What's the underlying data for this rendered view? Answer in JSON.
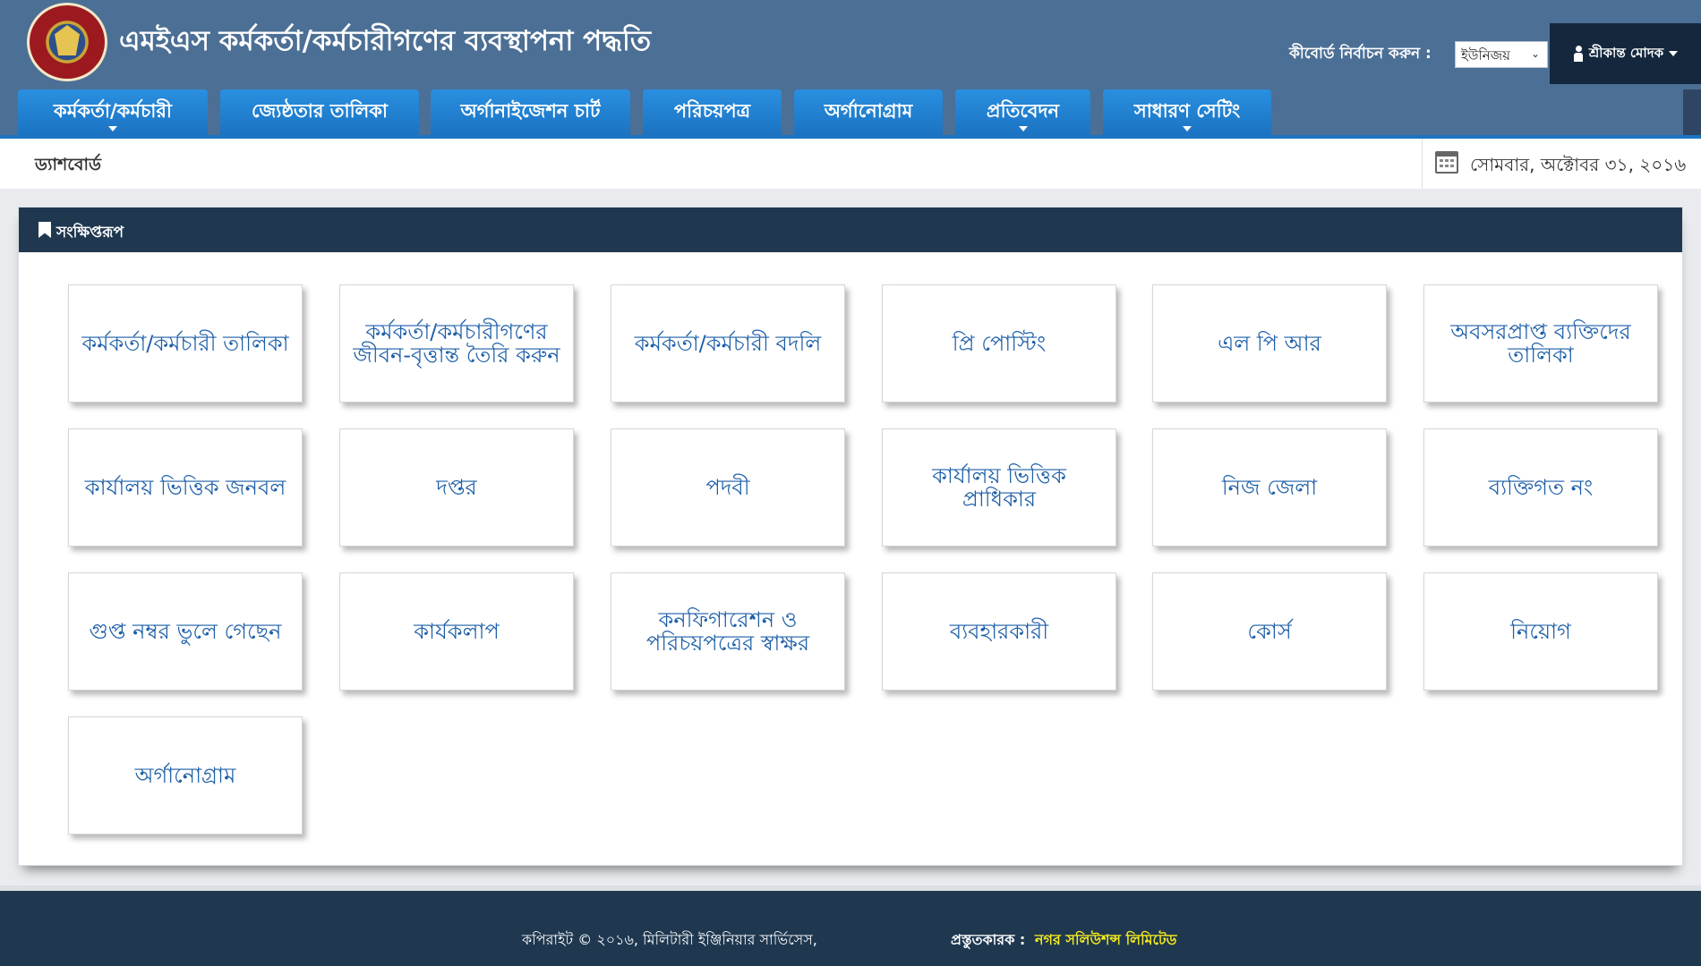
{
  "header": {
    "title": "এমইএস কর্মকর্তা/কর্মচারীগণের ব্যবস্থাপনা পদ্ধতি",
    "keyboard_label": "কীবোর্ড নির্বাচন করুন :",
    "keyboard_value": "ইউনিজয়",
    "user_name": "শ্রীকান্ত মোদক",
    "colors": {
      "header_bg": "#4c6f95",
      "user_bg": "#14273d"
    }
  },
  "nav": [
    {
      "label": "কর্মকর্তা/কর্মচারী",
      "dropdown": true
    },
    {
      "label": "জ্যেষ্ঠতার তালিকা",
      "dropdown": false
    },
    {
      "label": "অর্গানাইজেশন চার্ট",
      "dropdown": false
    },
    {
      "label": "পরিচয়পত্র",
      "dropdown": false
    },
    {
      "label": "অর্গানোগ্রাম",
      "dropdown": false
    },
    {
      "label": "প্রতিবেদন",
      "dropdown": true
    },
    {
      "label": "সাধারণ সেটিং",
      "dropdown": true
    }
  ],
  "breadcrumb": "ড্যাশবোর্ড",
  "date": "সোমবার, অক্টোবর ৩১, ২০১৬",
  "panel": {
    "title": "সংক্ষিপ্তরূপ",
    "tiles": [
      "কর্মকর্তা/কর্মচারী তালিকা",
      "কর্মকর্তা/কর্মচারীগণের জীবন-বৃত্তান্ত তৈরি করুন",
      "কর্মকর্তা/কর্মচারী বদলি",
      "প্রি পোস্টিং",
      "এল পি আর",
      "অবসরপ্রাপ্ত ব্যক্তিদের তালিকা",
      "কার্যালয় ভিত্তিক জনবল",
      "দপ্তর",
      "পদবী",
      "কার্যালয় ভিত্তিক প্রাধিকার",
      "নিজ জেলা",
      "ব্যক্তিগত নং",
      "গুপ্ত নম্বর ভুলে গেছেন",
      "কার্যকলাপ",
      "কনফিগারেশন ও পরিচয়পত্রের স্বাক্ষর",
      "ব্যবহারকারী",
      "কোর্স",
      "নিয়োগ",
      "অর্গানোগ্রাম"
    ]
  },
  "footer": {
    "copyright": "কপিরাইট © ২০১৬, মিলিটারী ইঞ্জিনিয়ার সার্ভিসেস,",
    "prepared_label": "প্রস্তুতকারক :",
    "prepared_by": "নগর সলিউশন্স লিমিটেড",
    "link_color": "#f4ea1d"
  }
}
